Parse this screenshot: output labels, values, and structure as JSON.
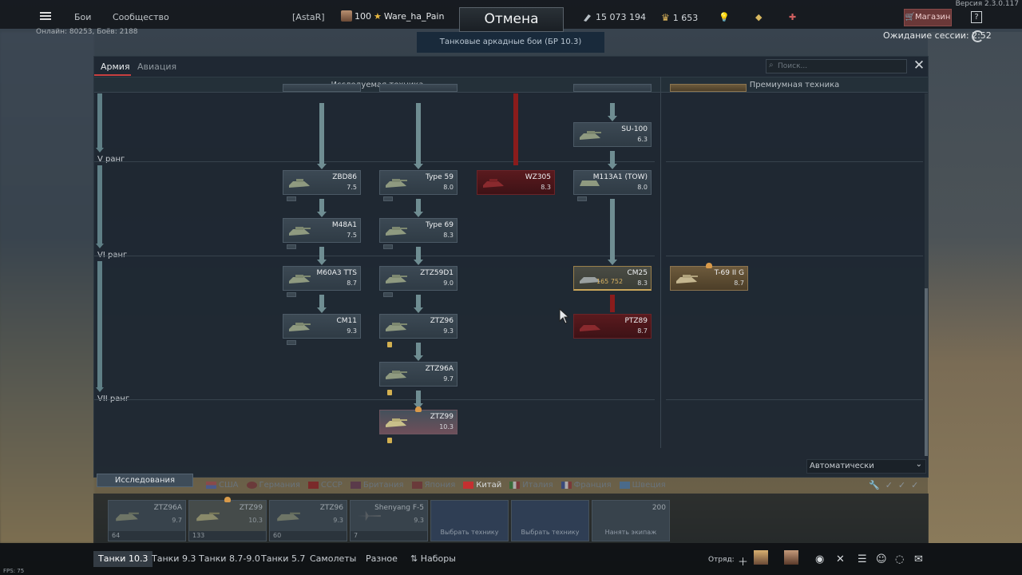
{
  "top": {
    "nav": [
      "Бои",
      "Сообщество"
    ],
    "online": "Онлайн: 80253, Боёв: 2188",
    "version": "Версия 2.3.0.117",
    "clan": "[AstaR]",
    "player_level": "100",
    "player_name": "Ware_ha_Pain",
    "cancel": "Отмена",
    "battle_mode": "Танковые аркадные бои (БР 10.3)",
    "silver": "15 073 194",
    "gold": "1 653",
    "shop": "Магазин",
    "help": "?",
    "waiting": "Ожидание сессии: 2:52"
  },
  "panel": {
    "tabs": [
      "Армия",
      "Авиация"
    ],
    "search_placeholder": "Поиск...",
    "col_research": "Исследуемая техника",
    "col_premium": "Премиумная техника",
    "ranks": [
      "V ранг",
      "VI ранг",
      "VII ранг"
    ]
  },
  "vehicles": {
    "top1": {
      "name": "",
      "br": ""
    },
    "su100": {
      "name": "SU-100",
      "br": "6.3"
    },
    "zbd86": {
      "name": "ZBD86",
      "br": "7.5"
    },
    "type59": {
      "name": "Type 59",
      "br": "8.0"
    },
    "wz305": {
      "name": "WZ305",
      "br": "8.3"
    },
    "m113a1": {
      "name": "M113A1 (TOW)",
      "br": "8.0"
    },
    "m48a1": {
      "name": "M48A1",
      "br": "7.5"
    },
    "type69": {
      "name": "Type 69",
      "br": "8.3"
    },
    "m60a3": {
      "name": "M60A3 TTS",
      "br": "8.7"
    },
    "ztz59d1": {
      "name": "ZTZ59D1",
      "br": "9.0"
    },
    "cm25": {
      "name": "CM25",
      "br": "8.3",
      "cost": "165 752"
    },
    "t69": {
      "name": "T-69 II G",
      "br": "8.7"
    },
    "cm11": {
      "name": "CM11",
      "br": "9.3"
    },
    "ztz96": {
      "name": "ZTZ96",
      "br": "9.3"
    },
    "ptz89": {
      "name": "PTZ89",
      "br": "8.7"
    },
    "ztz96a": {
      "name": "ZTZ96A",
      "br": "9.7"
    },
    "ztz99": {
      "name": "ZTZ99",
      "br": "10.3"
    }
  },
  "auto_select": "Автоматически",
  "research_tab": "Исследования",
  "nations": [
    "США",
    "Германия",
    "СССР",
    "Британия",
    "Япония",
    "Китай",
    "Италия",
    "Франция",
    "Швеция"
  ],
  "slots": [
    {
      "name": "ZTZ96A",
      "br": "9.7",
      "crew": "64"
    },
    {
      "name": "ZTZ99",
      "br": "10.3",
      "crew": "133"
    },
    {
      "name": "ZTZ96",
      "br": "9.3",
      "crew": "60"
    },
    {
      "name": "Shenyang F-5",
      "br": "9.3",
      "crew": "7"
    }
  ],
  "crew_slots": [
    "Выбрать технику",
    "Выбрать технику",
    "Нанять экипаж"
  ],
  "crew_cost": "200",
  "bottom": {
    "tabs": [
      "Танки 10.3",
      "Танки 9.3",
      "Танки 8.7-9.0",
      "Танки 5.7",
      "Самолеты",
      "Разное",
      "Наборы"
    ],
    "squad": "Отряд:"
  },
  "fps": "FPS: 75",
  "colors": {
    "accent_red": "#c94040",
    "gold": "#d7b060",
    "connector": "#6f8d92"
  }
}
